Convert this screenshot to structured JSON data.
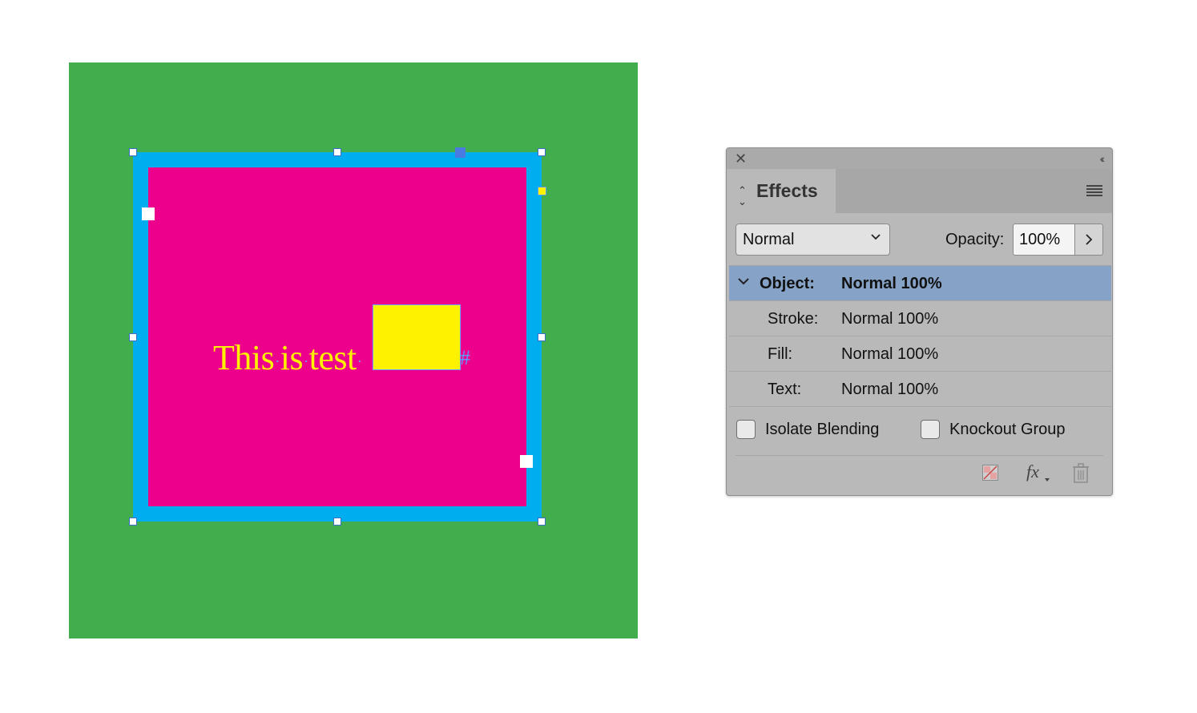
{
  "canvas": {
    "text_words": [
      "This",
      "is",
      "test"
    ],
    "end_marker": "#",
    "colors": {
      "background": "#42ad4c",
      "frame": "#00aeef",
      "fill": "#ec008c",
      "text": "#fff200",
      "inline_box": "#fff200",
      "selection": "#4a7be0"
    }
  },
  "panel": {
    "title": "Effects",
    "close_icon": "close-icon",
    "collapse_icon": "double-chevron-left-icon",
    "menu_icon": "hamburger-menu-icon",
    "blend_mode": "Normal",
    "opacity_label": "Opacity:",
    "opacity_value": "100%",
    "rows": [
      {
        "target": "Object:",
        "value": "Normal 100%",
        "selected": true
      },
      {
        "target": "Stroke:",
        "value": "Normal 100%"
      },
      {
        "target": "Fill:",
        "value": "Normal 100%"
      },
      {
        "target": "Text:",
        "value": "Normal 100%"
      }
    ],
    "isolate_blending_label": "Isolate Blending",
    "knockout_group_label": "Knockout Group",
    "isolate_blending_checked": false,
    "knockout_group_checked": false,
    "footer_icons": [
      "clear-effects-icon",
      "fx-icon",
      "trash-icon"
    ]
  }
}
